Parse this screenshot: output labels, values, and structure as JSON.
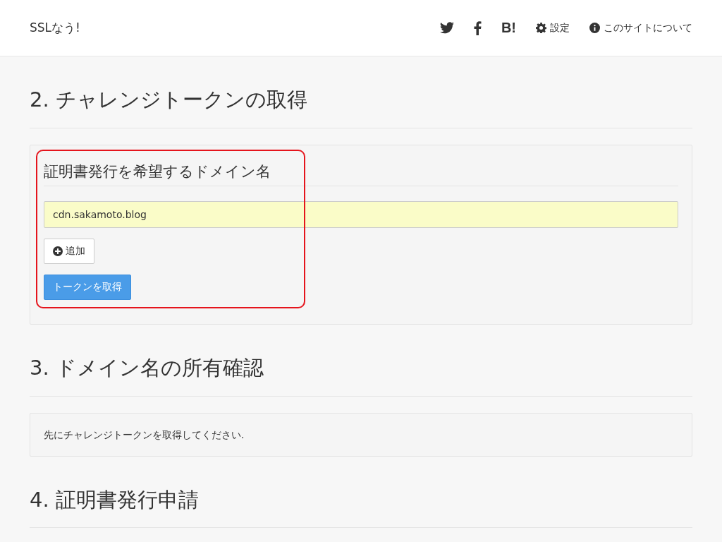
{
  "navbar": {
    "brand": "SSLなう!",
    "items": [
      {
        "kind": "twitter"
      },
      {
        "kind": "facebook"
      },
      {
        "kind": "text",
        "label": "B!"
      },
      {
        "kind": "settings",
        "label": "設定"
      },
      {
        "kind": "info",
        "label": "このサイトについて"
      }
    ]
  },
  "sections": [
    {
      "heading": "2. チャレンジトークンの取得",
      "panel": {
        "kind": "form",
        "title": "証明書発行を希望するドメイン名",
        "domains": [
          "cdn.sakamoto.blog"
        ],
        "add_button": "追加",
        "submit_button": "トークンを取得",
        "highlighted": true
      }
    },
    {
      "heading": "3. ドメイン名の所有確認",
      "panel": {
        "kind": "message",
        "text": "先にチャレンジトークンを取得してください."
      }
    },
    {
      "heading": "4. 証明書発行申請"
    }
  ]
}
